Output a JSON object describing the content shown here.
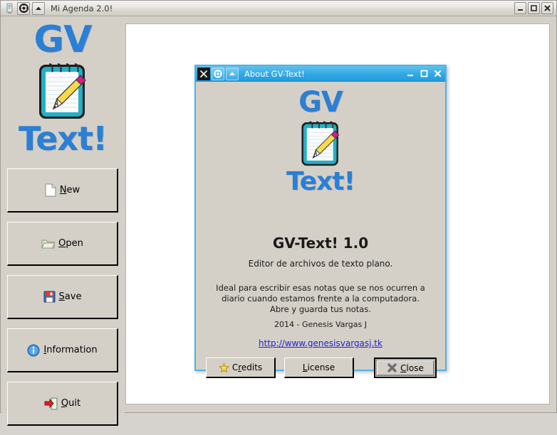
{
  "main_window": {
    "title": "Mi Agenda 2.0!",
    "titlebar_icons": [
      "app-text-icon",
      "gear-icon",
      "chevron-up-icon"
    ],
    "window_buttons": {
      "minimize": "minimize-icon",
      "maximize": "maximize-icon",
      "close": "close-icon"
    }
  },
  "sidebar": {
    "logo": {
      "line1": "GV",
      "line2": "Text!",
      "icon": "notepad-pencil-icon",
      "color": "#2b7fd4"
    },
    "buttons": [
      {
        "label_pre": "",
        "accel": "N",
        "label_post": "ew",
        "full": "New",
        "icon": "new-document-icon"
      },
      {
        "label_pre": "",
        "accel": "O",
        "label_post": "pen",
        "full": "Open",
        "icon": "open-folder-icon"
      },
      {
        "label_pre": "",
        "accel": "S",
        "label_post": "ave",
        "full": "Save",
        "icon": "save-floppy-icon"
      },
      {
        "label_pre": "",
        "accel": "I",
        "label_post": "nformation",
        "full": "Information",
        "icon": "info-circle-icon"
      },
      {
        "label_pre": "",
        "accel": "Q",
        "label_post": "uit",
        "full": "Quit",
        "icon": "exit-door-icon"
      }
    ]
  },
  "about_dialog": {
    "title": "About GV-Text!",
    "titlebar_icons": [
      "close-x-icon",
      "gear-icon",
      "chevron-up-icon"
    ],
    "window_buttons": {
      "minimize": "minimize-icon",
      "maximize": "maximize-icon",
      "close": "close-icon"
    },
    "logo": {
      "line1": "GV",
      "line2": "Text!",
      "icon": "notepad-pencil-icon"
    },
    "app_title": "GV-Text! 1.0",
    "subtitle": "Editor de archivos de texto plano.",
    "description": "Ideal para escribir esas notas que se nos ocurren a\ndiario cuando estamos frente a la computadora.\nAbre y guarda tus notas.",
    "copyright": "2014 - Genesis Vargas J",
    "link": "http://www.genesisvargasj.tk",
    "link_color": "#2222cc",
    "buttons": [
      {
        "accel": "C",
        "rest_pre": "r",
        "rest_post": "edits",
        "full": "Credits",
        "icon": "star-icon",
        "focused": false
      },
      {
        "accel": "L",
        "rest_pre": "",
        "rest_post": "icense",
        "full": "License",
        "icon": "none",
        "focused": false
      },
      {
        "accel": "C",
        "rest_pre": "",
        "rest_post": "lose",
        "full": "Close",
        "icon": "close-x-gray-icon",
        "focused": true
      }
    ]
  },
  "theme": {
    "window_bg": "#d4d0c8",
    "content_bg": "#ffffff",
    "dialog_accent": "#36a9e4",
    "logo_blue": "#2b7fd4",
    "notepad_teal": "#1fa5bd",
    "pencil_yellow": "#f5d03e",
    "eraser_magenta": "#d81b8c"
  }
}
